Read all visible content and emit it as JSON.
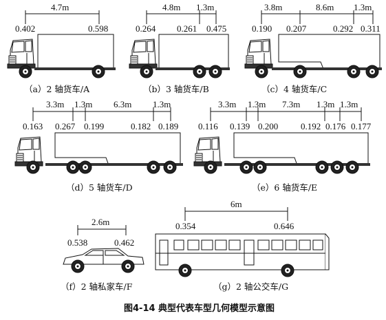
{
  "figure_title": "图4-14  典型代表车型几何模型示意图",
  "vehicles": {
    "A": {
      "caption": "（a）2 轴货车/A",
      "spacings": [
        "4.7m"
      ],
      "load_ratios": [
        "0.402",
        "0.598"
      ]
    },
    "B": {
      "caption": "（b）3 轴货车/B",
      "spacings": [
        "4.8m",
        "1.3m"
      ],
      "load_ratios": [
        "0.264",
        "0.261",
        "0.475"
      ]
    },
    "C": {
      "caption": "（c）4 轴货车/C",
      "spacings": [
        "3.8m",
        "8.6m",
        "1.3m"
      ],
      "load_ratios": [
        "0.190",
        "0.207",
        "0.292",
        "0.311"
      ]
    },
    "D": {
      "caption": "（d）5 轴货车/D",
      "spacings": [
        "3.3m",
        "1.3m",
        "6.3m",
        "1.3m"
      ],
      "load_ratios": [
        "0.163",
        "0.267",
        "0.199",
        "0.182",
        "0.189"
      ]
    },
    "E": {
      "caption": "（e）6 轴货车/E",
      "spacings": [
        "3.3m",
        "1.3m",
        "7.3m",
        "1.3m",
        "1.3m"
      ],
      "load_ratios": [
        "0.116",
        "0.139",
        "0.200",
        "0.192",
        "0.176",
        "0.177"
      ]
    },
    "F": {
      "caption": "（f）2 轴私家车/F",
      "spacings": [
        "2.6m"
      ],
      "load_ratios": [
        "0.538",
        "0.462"
      ]
    },
    "G": {
      "caption": "（g）2 轴公交车/G",
      "spacings": [
        "6m"
      ],
      "load_ratios": [
        "0.354",
        "0.646"
      ]
    }
  }
}
